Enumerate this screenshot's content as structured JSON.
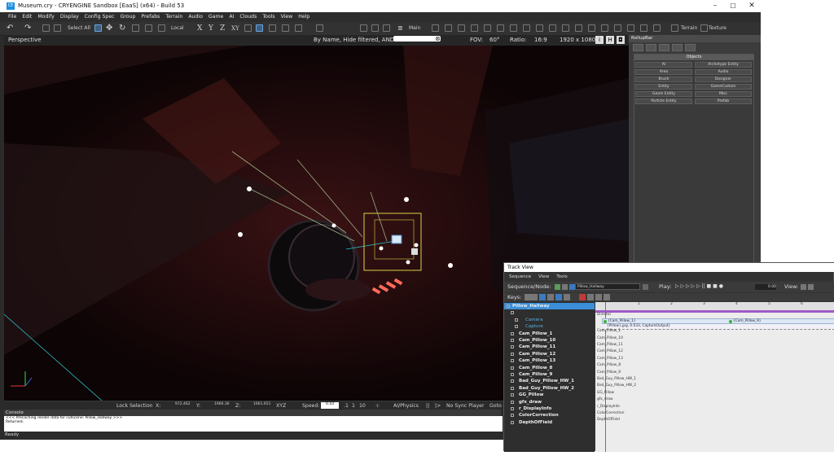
{
  "window": {
    "title": "Museum.cry - CRYENGINE Sandbox [EaaS] (x64) - Build 53",
    "icon_label": "CE",
    "controls": [
      "–",
      "☐",
      "✕"
    ]
  },
  "menu": [
    "File",
    "Edit",
    "Modify",
    "Display",
    "Config Spec",
    "Group",
    "Prefabs",
    "Terrain",
    "Audio",
    "Game",
    "AI",
    "Clouds",
    "Tools",
    "View",
    "Help"
  ],
  "toolbar": {
    "select_all": "Select All",
    "coord_system": "Local",
    "axes": [
      "X",
      "Y",
      "Z",
      "XY"
    ],
    "main_label": "Main",
    "terrain_label": "Terrain",
    "texture_label": "Texture"
  },
  "viewport_header": {
    "mode": "Perspective",
    "filter": "By Name, Hide filtered, AND",
    "fov_label": "FOV:",
    "fov_value": "60°",
    "ratio_label": "Ratio:",
    "ratio_value": "16:9",
    "resolution": "1920 x 1080"
  },
  "statusbar": {
    "lock": "Lock Selection",
    "x_label": "X:",
    "x_value": "972.462",
    "y_label": "Y:",
    "y_value": "1966.36",
    "z_label": "Z:",
    "z_value": "1661.651",
    "xyz": "XYZ",
    "speed_label": "Speed:",
    "speed_value": "0.10",
    "speed_buttons": [
      ".1",
      "1",
      "10"
    ],
    "ai_physics": "AI/Physics",
    "sync": "No Sync Player",
    "goto": "Goto"
  },
  "console": {
    "title": "Console",
    "lines": [
      "<<< Precaching render data for cutscene: Pillow_Hallway >>>",
      "Returned."
    ],
    "status": "Ready"
  },
  "rollup": {
    "title": "RollupBar",
    "objects_header": "Objects",
    "buttons": [
      "AI",
      "Archetype Entity",
      "Area",
      "Audio",
      "Brush",
      "Designer",
      "Entity",
      "GameCustom",
      "Geom Entity",
      "Misc",
      "Particle Entity",
      "Prefab"
    ]
  },
  "trackview": {
    "title": "Track View",
    "menu": [
      "Sequence",
      "View",
      "Tools"
    ],
    "sequence_label": "Sequence/Node:",
    "sequence_name": "Pillow_Hallway",
    "play_label": "Play:",
    "time_value": "0.00",
    "view_label": "View:",
    "keys_label": "Keys:",
    "tree": [
      {
        "label": "Pillow_Hallway",
        "level": 0,
        "selected": true
      },
      {
        "label": "",
        "level": 1,
        "selected": false
      },
      {
        "label": "Camera",
        "level": 2,
        "selected": false,
        "dim": true
      },
      {
        "label": "Capture",
        "level": 2,
        "selected": false,
        "dim": true
      },
      {
        "label": "Cam_Pillow_1",
        "level": 1,
        "selected": false
      },
      {
        "label": "Cam_Pillow_10",
        "level": 1,
        "selected": false
      },
      {
        "label": "Cam_Pillow_11",
        "level": 1,
        "selected": false
      },
      {
        "label": "Cam_Pillow_12",
        "level": 1,
        "selected": false
      },
      {
        "label": "Cam_Pillow_13",
        "level": 1,
        "selected": false
      },
      {
        "label": "Cam_Pillow_8",
        "level": 1,
        "selected": false
      },
      {
        "label": "Cam_Pillow_9",
        "level": 1,
        "selected": false
      },
      {
        "label": "Bad_Guy_Pillow_HW_1",
        "level": 1,
        "selected": false
      },
      {
        "label": "Bad_Guy_Pillow_HW_2",
        "level": 1,
        "selected": false
      },
      {
        "label": "GG_Pillow",
        "level": 1,
        "selected": false
      },
      {
        "label": "gfx_draw",
        "level": 1,
        "selected": false
      },
      {
        "label": "r_DisplayInfo",
        "level": 1,
        "selected": false
      },
      {
        "label": "ColorCorrection",
        "level": 1,
        "selected": false
      },
      {
        "label": "DepthOfField",
        "level": 1,
        "selected": false
      }
    ],
    "timeline_rows": [
      "Director",
      "",
      "",
      "Cam_Pillow_1",
      "Cam_Pillow_10",
      "Cam_Pillow_11",
      "Cam_Pillow_12",
      "Cam_Pillow_13",
      "Cam_Pillow_8",
      "Cam_Pillow_9",
      "Bad_Guy_Pillow_HW_1",
      "Bad_Guy_Pillow_HW_2",
      "GG_Pillow",
      "gfx_draw",
      "r_DisplayInfo",
      "ColorCorrection",
      "DepthOfField"
    ],
    "keys": [
      "{Cam_Pillow_1}",
      "{Cam_Pillow_9}",
      "{Pillow},jpg, 0.033, CaptureOutput}"
    ],
    "ruler": [
      "0",
      "1",
      "2",
      "3",
      "4",
      "5",
      "6"
    ]
  }
}
